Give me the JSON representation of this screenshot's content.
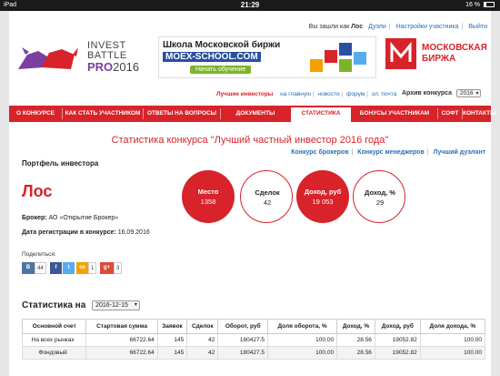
{
  "status": {
    "device": "iPad",
    "time": "21:29",
    "battery": "16 %"
  },
  "header": {
    "logged_as": "Вы зашли как",
    "user": "Лос",
    "links": [
      "Дуэли",
      "Настройки участника",
      "Выйти"
    ],
    "logo": {
      "line1": "INVEST",
      "line2": "BATTLE",
      "pro": "PRO",
      "year": "2016"
    },
    "banner": {
      "line1": "Школа Московской биржи",
      "line2": "MOEX-SCHOOL.COM",
      "cta": "Начать обучение"
    },
    "moex": {
      "line1": "МОСКОВСКАЯ",
      "line2": "БИРЖА"
    }
  },
  "subnav": {
    "best": "Лучшие инвесторы",
    "links": [
      "на главную",
      "новости",
      "форум",
      "эл. почта"
    ],
    "archive_label": "Архив конкурса",
    "archive_value": "2016"
  },
  "menu": {
    "items": [
      "О КОНКУРСЕ",
      "КАК СТАТЬ УЧАСТНИКОМ",
      "ОТВЕТЫ НА ВОПРОСЫ",
      "ДОКУМЕНТЫ",
      "СТАТИСТИКА",
      "БОНУСЫ УЧАСТНИКАМ",
      "СОФТ",
      "КОНТАКТЫ"
    ],
    "active": "СТАТИСТИКА"
  },
  "title": "Статистика конкурса \"Лучший частный инвестор 2016 года\"",
  "tabs": [
    "Конкурс брокеров",
    "Конкурс менеджеров",
    "Лучший дуэлянт"
  ],
  "portfolio": {
    "heading": "Портфель инвестора",
    "name": "Лос",
    "broker_label": "Брокер:",
    "broker": "АО «Открытие Брокер»",
    "reg_label": "Дата регистрации в конкурсе:",
    "reg_date": "16.09.2016"
  },
  "metrics": [
    {
      "label": "Место",
      "value": "1358",
      "style": "red"
    },
    {
      "label": "Сделок",
      "value": "42",
      "style": "outline"
    },
    {
      "label": "Доход, руб",
      "value": "19 053",
      "style": "red"
    },
    {
      "label": "Доход, %",
      "value": "29",
      "style": "outline"
    }
  ],
  "share": {
    "label": "Поделиться:",
    "vk_count": "44",
    "ok_count": "1",
    "gplus_count": "3",
    "colors": {
      "vk": "#4c75a3",
      "fb": "#3b5998",
      "tw": "#55acee",
      "ok": "#f2a100",
      "gplus": "#dd4b39"
    }
  },
  "stats": {
    "heading": "Статистика на",
    "date": "2016-12-15",
    "columns": [
      "Основной счет",
      "Стартовая сумма",
      "Заявок",
      "Сделок",
      "Оборот, руб",
      "Доля оборота, %",
      "Доход, %",
      "Доход, руб",
      "Доля дохода, %"
    ],
    "rows": [
      [
        "На всех рынках",
        "66722.64",
        "145",
        "42",
        "180427.5",
        "100.00",
        "28.56",
        "19052.82",
        "100.00"
      ],
      [
        "Фондовый",
        "66722.64",
        "145",
        "42",
        "180427.5",
        "100.00",
        "28.56",
        "19052.82",
        "100.00"
      ]
    ]
  },
  "colors": {
    "accent": "#d8232a",
    "link": "#2a6fb5"
  }
}
